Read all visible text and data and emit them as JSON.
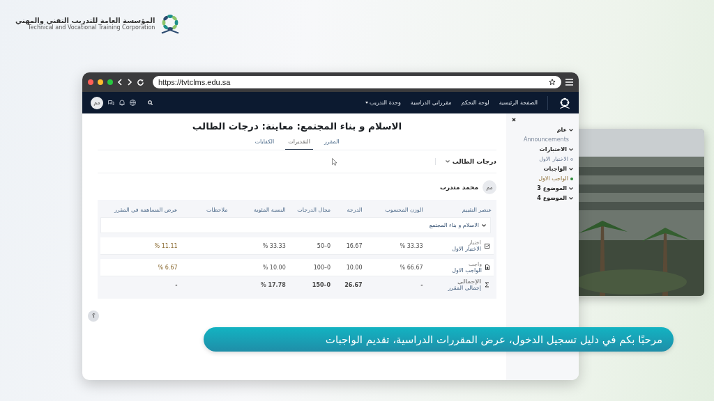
{
  "brand": {
    "name_ar": "المؤسسة العامة للتدريب التقني والمهني",
    "name_en": "Technical and Vocational Training Corporation"
  },
  "browser": {
    "url": "https://tvtclms.edu.sa"
  },
  "navbar": {
    "links": [
      {
        "label": "الصفحة الرئيسية",
        "dropdown": false
      },
      {
        "label": "لوحة التحكم",
        "dropdown": false
      },
      {
        "label": "مقرراتي الدراسية",
        "dropdown": false
      },
      {
        "label": "وحدة التدريب",
        "dropdown": true
      }
    ],
    "avatar": "مم"
  },
  "drawer": {
    "items": [
      {
        "kind": "section",
        "label": "عام"
      },
      {
        "kind": "link",
        "label": "Announcements"
      },
      {
        "kind": "section",
        "label": "الاختبارات"
      },
      {
        "kind": "activity",
        "label": "الاختبار الاول",
        "completed": false
      },
      {
        "kind": "section",
        "label": "الواجبات"
      },
      {
        "kind": "activity",
        "label": "الواجب الاول",
        "completed": true
      },
      {
        "kind": "section",
        "label": "الموضوع 3"
      },
      {
        "kind": "section",
        "label": "الموضوع 4"
      }
    ]
  },
  "page": {
    "title": "الاسلام و بناء المجتمع: معاينة: درجات الطالب",
    "tabs": [
      {
        "label": "المقرر",
        "selected": false
      },
      {
        "label": "التقديرات",
        "selected": true
      },
      {
        "label": "الكفايات",
        "selected": false
      }
    ],
    "report_select": "درجات الطالب",
    "user": {
      "initials": "مم",
      "name": "محمد متدرب"
    }
  },
  "table": {
    "columns": [
      "عنصر التقييم",
      "الوزن المحسوب",
      "الدرجة",
      "مجال الدرجات",
      "النسبة المئوية",
      "ملاحظات",
      "عرض المساهمة في المقرر"
    ],
    "category": "الاسلام و بناء المجتمع",
    "rows": [
      {
        "kind": "quiz",
        "type": "اختبار",
        "name": "الاختبار الاول",
        "weight": "33.33 %",
        "grade": "16.67",
        "range": "0–50",
        "percentage": "33.33 %",
        "contribution": "11.11 %"
      },
      {
        "kind": "assignment",
        "type": "واجب",
        "name": "الواجب الاول",
        "weight": "66.67 %",
        "grade": "10.00",
        "range": "0–100",
        "percentage": "10.00 %",
        "contribution": "6.67 %"
      },
      {
        "kind": "total",
        "type": "الإجمالي",
        "name": "إجمالي المقرر",
        "weight": "-",
        "grade": "26.67",
        "range": "0–150",
        "percentage": "17.78 %",
        "contribution": "-"
      }
    ]
  },
  "help_button": "؟",
  "caption": "مرحبًا بكم في دليل تسجيل الدخول، عرض المقررات الدراسية، تقديم الواجبات"
}
